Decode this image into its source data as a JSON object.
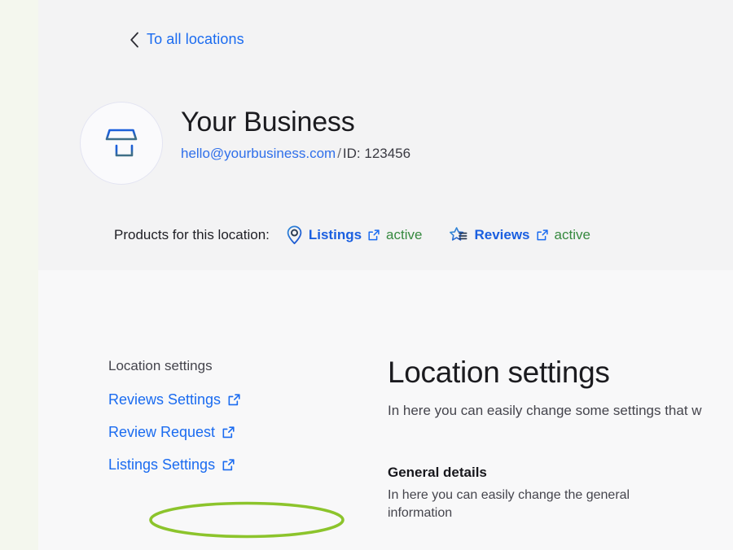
{
  "back_nav": {
    "label": "To all locations",
    "icon": "chevron-left-icon"
  },
  "business": {
    "avatar_icon": "storefront-icon",
    "name": "Your Business",
    "email": "hello@yourbusiness.com",
    "separator": "/",
    "id_text": "ID: 123456"
  },
  "products": {
    "label": "Products for this location:",
    "items": [
      {
        "icon": "map-pin-icon",
        "name": "Listings",
        "link_icon": "external-link-icon",
        "status": "active"
      },
      {
        "icon": "star-list-icon",
        "name": "Reviews",
        "link_icon": "external-link-icon",
        "status": "active"
      }
    ]
  },
  "sidebar": {
    "title": "Location settings",
    "links": [
      {
        "label": "Reviews Settings",
        "icon": "external-link-icon"
      },
      {
        "label": "Review Request",
        "icon": "external-link-icon"
      },
      {
        "label": "Listings Settings",
        "icon": "external-link-icon"
      }
    ]
  },
  "annotation": {
    "type": "ellipse-highlight",
    "target": "Review Request",
    "color": "#8cc42c"
  },
  "main": {
    "title": "Location settings",
    "subtitle": "In here you can easily change some settings that w",
    "sections": [
      {
        "heading": "General details",
        "text": "In here you can easily change the general information"
      }
    ]
  },
  "colors": {
    "link_blue": "#1a6bf0",
    "product_blue": "#1a5fe0",
    "status_green": "#36893f",
    "annotation_green": "#8cc42c",
    "header_bg": "#f3f3f4",
    "body_bg": "#f8f8f9",
    "left_margin_bg": "#f4f7ee"
  }
}
